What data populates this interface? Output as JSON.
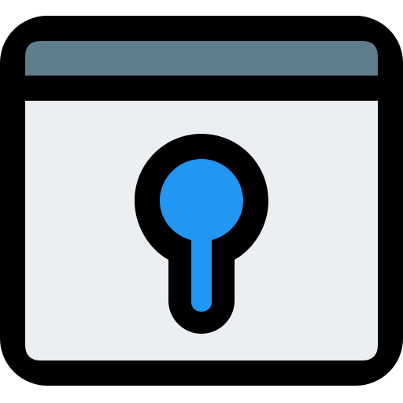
{
  "icon": {
    "name": "browser-window-keyhole-icon",
    "colors": {
      "outline": "#000000",
      "title_bar": "#607D8B",
      "window_body": "#ECEFF1",
      "keyhole": "#2196F3"
    }
  }
}
